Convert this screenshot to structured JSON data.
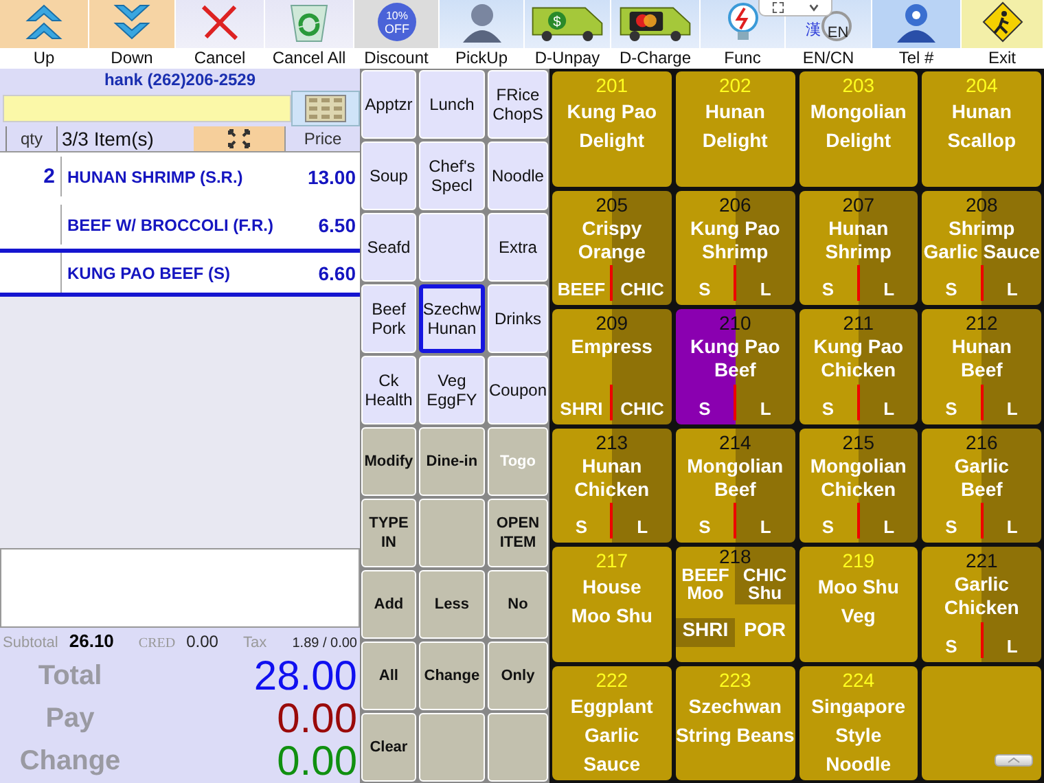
{
  "toolbar": [
    {
      "kind": "up",
      "label": "Up"
    },
    {
      "kind": "down",
      "label": "Down"
    },
    {
      "kind": "cancel",
      "label": "Cancel"
    },
    {
      "kind": "cancel-all",
      "label": "Cancel All"
    },
    {
      "kind": "discount",
      "label": "Discount",
      "icon_text": [
        "10%",
        "OFF"
      ]
    },
    {
      "kind": "pickup",
      "label": "PickUp"
    },
    {
      "kind": "van-cash",
      "label": "D-Unpay",
      "icon_text": [
        "$"
      ]
    },
    {
      "kind": "van-card",
      "label": "D-Charge"
    },
    {
      "kind": "func",
      "label": "Func"
    },
    {
      "kind": "lang",
      "label": "EN/CN",
      "icon_text": [
        "漢",
        "EN"
      ]
    },
    {
      "kind": "phone",
      "label": "Tel #"
    },
    {
      "kind": "exit",
      "label": "Exit"
    }
  ],
  "customer": "hank (262)206-2529",
  "order": {
    "qty_header": "qty",
    "count": "3/3 Item(s)",
    "price_header": "Price",
    "rows": [
      {
        "qty": "2",
        "name": "HUNAN SHRIMP  (S.R.)",
        "price": "13.00",
        "selected": false
      },
      {
        "name": "BEEF W/ BROCCOLI  (F.R.)",
        "price": "6.50",
        "selected": false
      },
      {
        "name": "KUNG PAO BEEF  (S)",
        "price": "6.60",
        "selected": true
      }
    ]
  },
  "summary": {
    "subtotal_label": "Subtotal",
    "subtotal": "26.10",
    "credit_label": "CRED",
    "credit": "0.00",
    "tax_label": "Tax",
    "tax": "1.89 / 0.00"
  },
  "totals": [
    {
      "kind": "total",
      "label": "Total",
      "value": "28.00"
    },
    {
      "kind": "pay",
      "label": "Pay",
      "value": "0.00"
    },
    {
      "kind": "change",
      "label": "Change",
      "value": "0.00"
    }
  ],
  "categories": [
    {
      "label": "Apptzr",
      "selected": false
    },
    {
      "label": "Lunch",
      "selected": false
    },
    {
      "label": "FRice ChopS",
      "selected": false
    },
    {
      "label": "Soup",
      "selected": false
    },
    {
      "label": "Chef's Specl",
      "selected": false
    },
    {
      "label": "Noodle",
      "selected": false
    },
    {
      "label": "Seafd",
      "selected": false
    },
    {
      "selected": false
    },
    {
      "label": "Extra",
      "selected": false
    },
    {
      "label": "Beef Pork",
      "selected": false
    },
    {
      "label": "Szechw Hunan",
      "selected": true
    },
    {
      "label": "Drinks",
      "selected": false
    },
    {
      "label": "Ck Health",
      "selected": false
    },
    {
      "label": "Veg EggFY",
      "selected": false
    },
    {
      "label": "Coupon",
      "selected": false
    }
  ],
  "functions": [
    {
      "label": "Modify",
      "on": false
    },
    {
      "label": "Dine-in",
      "on": false
    },
    {
      "label": "Togo",
      "on": true
    },
    {
      "label": "TYPE IN",
      "on": false
    },
    {
      "on": false
    },
    {
      "label": "OPEN ITEM",
      "on": false
    },
    {
      "label": "Add",
      "on": false
    },
    {
      "label": "Less",
      "on": false
    },
    {
      "label": "No",
      "on": false
    },
    {
      "label": "All",
      "on": false
    },
    {
      "label": "Change",
      "on": false
    },
    {
      "label": "Only",
      "on": false
    },
    {
      "label": "Clear",
      "on": false
    },
    {
      "on": false
    },
    {
      "on": false
    }
  ],
  "menu": [
    {
      "kind": "plain",
      "number": "201",
      "lines": [
        "Kung Pao",
        "Delight"
      ],
      "selected": false
    },
    {
      "kind": "plain",
      "number": "202",
      "lines": [
        "Hunan",
        "Delight"
      ],
      "selected": false
    },
    {
      "kind": "plain",
      "number": "203",
      "lines": [
        "Mongolian",
        "Delight"
      ],
      "selected": false
    },
    {
      "kind": "plain",
      "number": "204",
      "lines": [
        "Hunan",
        "Scallop"
      ],
      "selected": false
    },
    {
      "kind": "split",
      "number": "205",
      "lines": [
        "Crispy",
        "Orange"
      ],
      "options": [
        "BEEF",
        "CHIC"
      ],
      "selected": false
    },
    {
      "kind": "split",
      "number": "206",
      "lines": [
        "Kung Pao",
        "Shrimp"
      ],
      "options": [
        "S",
        "L"
      ],
      "selected": false
    },
    {
      "kind": "split",
      "number": "207",
      "lines": [
        "Hunan",
        "Shrimp"
      ],
      "options": [
        "S",
        "L"
      ],
      "selected": false
    },
    {
      "kind": "split",
      "number": "208",
      "lines": [
        "Shrimp",
        "Garlic Sauce"
      ],
      "options": [
        "S",
        "L"
      ],
      "selected": false
    },
    {
      "kind": "split",
      "number": "209",
      "lines": [
        "Empress"
      ],
      "options": [
        "SHRI",
        "CHIC"
      ],
      "selected": false
    },
    {
      "kind": "split",
      "number": "210",
      "lines": [
        "Kung Pao",
        "Beef"
      ],
      "options": [
        "S",
        "L"
      ],
      "selected": true
    },
    {
      "kind": "split",
      "number": "211",
      "lines": [
        "Kung Pao",
        "Chicken"
      ],
      "options": [
        "S",
        "L"
      ],
      "selected": false
    },
    {
      "kind": "split",
      "number": "212",
      "lines": [
        "Hunan",
        "Beef"
      ],
      "options": [
        "S",
        "L"
      ],
      "selected": false
    },
    {
      "kind": "split",
      "number": "213",
      "lines": [
        "Hunan",
        "Chicken"
      ],
      "options": [
        "S",
        "L"
      ],
      "selected": false
    },
    {
      "kind": "split",
      "number": "214",
      "lines": [
        "Mongolian",
        "Beef"
      ],
      "options": [
        "S",
        "L"
      ],
      "selected": false
    },
    {
      "kind": "split",
      "number": "215",
      "lines": [
        "Mongolian",
        "Chicken"
      ],
      "options": [
        "S",
        "L"
      ],
      "selected": false
    },
    {
      "kind": "split",
      "number": "216",
      "lines": [
        "Garlic",
        "Beef"
      ],
      "options": [
        "S",
        "L"
      ],
      "selected": false
    },
    {
      "kind": "plain",
      "number": "217",
      "lines": [
        "House",
        "Moo Shu"
      ],
      "selected": false
    },
    {
      "kind": "quad",
      "number": "218",
      "lines": [
        "Moo",
        "Shu"
      ],
      "options": [
        "BEEF",
        "CHIC",
        "SHRI",
        "POR"
      ],
      "selected": false
    },
    {
      "kind": "plain",
      "number": "219",
      "lines": [
        "Moo Shu",
        "Veg"
      ],
      "selected": false
    },
    {
      "kind": "split",
      "number": "221",
      "lines": [
        "Garlic",
        "Chicken"
      ],
      "options": [
        "S",
        "L"
      ],
      "selected": false
    },
    {
      "kind": "plain",
      "number": "222",
      "lines": [
        "Eggplant",
        "Garlic",
        "Sauce"
      ],
      "selected": false
    },
    {
      "kind": "plain",
      "number": "223",
      "lines": [
        "Szechwan",
        "String Beans"
      ],
      "selected": false
    },
    {
      "kind": "plain",
      "number": "224",
      "lines": [
        "Singapore",
        "Style",
        "Noodle"
      ],
      "selected": false
    },
    {
      "kind": "blank",
      "selected": false
    }
  ]
}
